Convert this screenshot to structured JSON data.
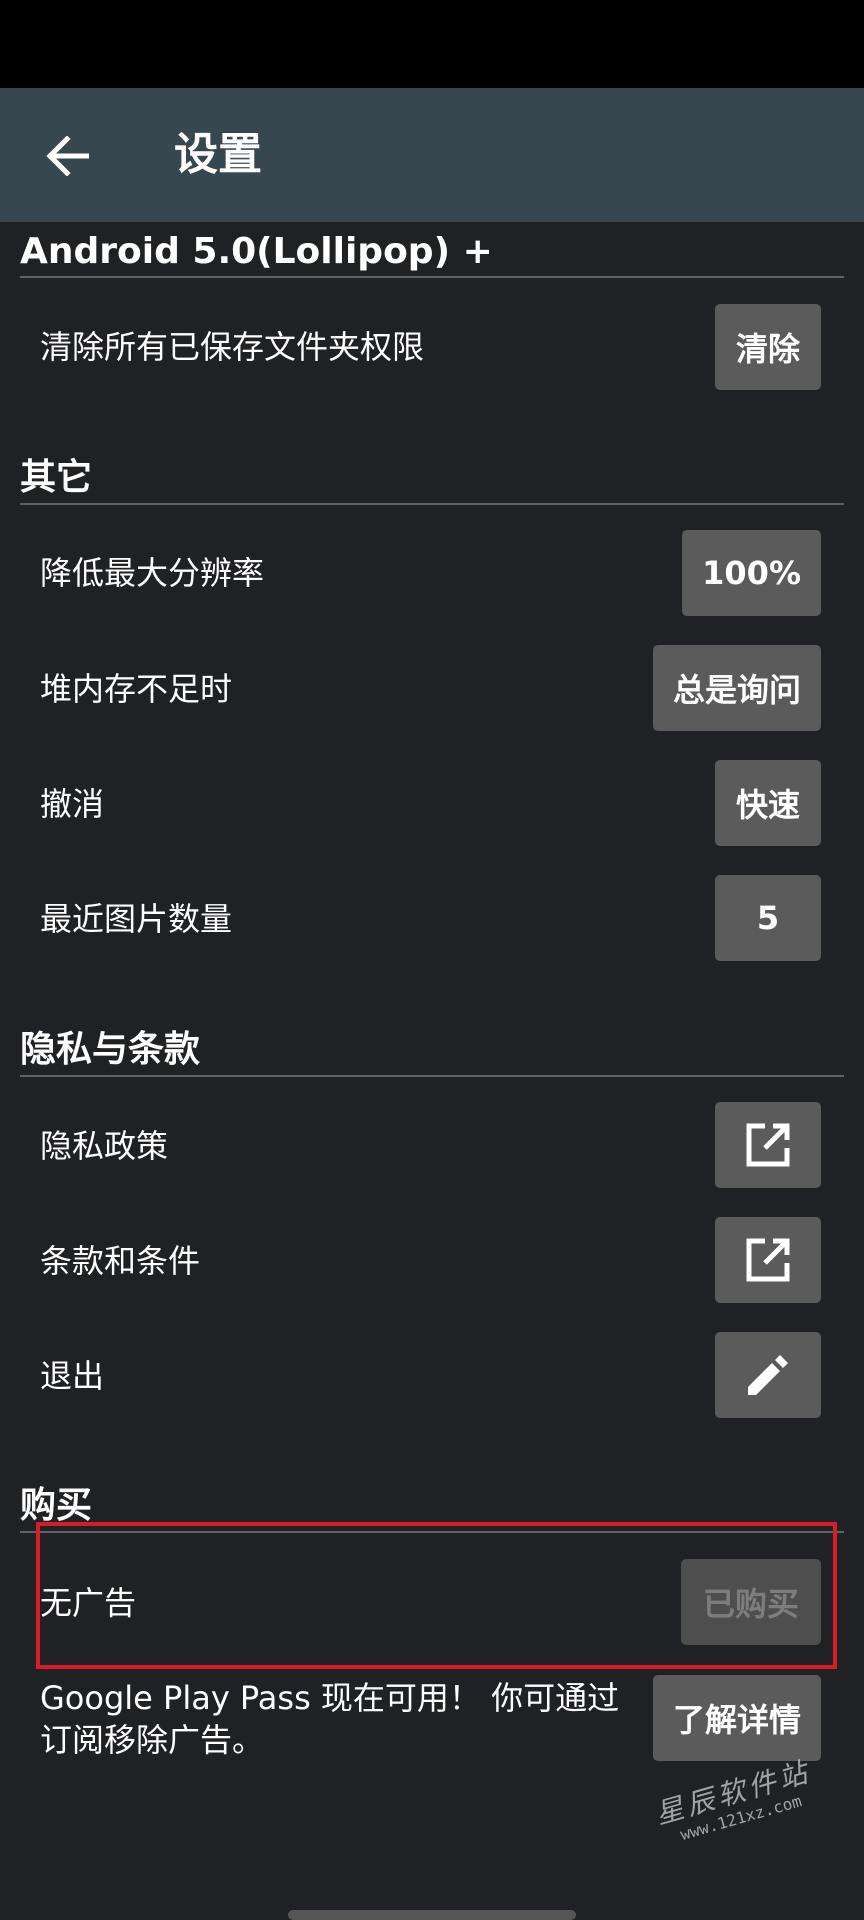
{
  "header": {
    "title": "设置",
    "back_icon": "arrow-left-icon"
  },
  "sections": {
    "android": {
      "title": "Android 5.0(Lollipop) +",
      "clear_permissions": {
        "label": "清除所有已保存文件夹权限",
        "button": "清除"
      }
    },
    "other": {
      "title": "其它",
      "reduce_resolution": {
        "label": "降低最大分辨率",
        "button": "100%"
      },
      "heap_insufficient": {
        "label": "堆内存不足时",
        "button": "总是询问"
      },
      "undo": {
        "label": "撤消",
        "button": "快速"
      },
      "recent_images": {
        "label": "最近图片数量",
        "button": "5"
      }
    },
    "privacy": {
      "title": "隐私与条款",
      "privacy_policy": {
        "label": "隐私政策",
        "icon": "open-external-icon"
      },
      "terms": {
        "label": "条款和条件",
        "icon": "open-external-icon"
      },
      "exit": {
        "label": "退出",
        "icon": "pencil-icon"
      }
    },
    "purchase": {
      "title": "购买",
      "no_ads": {
        "label": "无广告",
        "button": "已购买"
      },
      "play_pass": {
        "text": "Google Play Pass 现在可用！ 你可通过订阅移除广告。",
        "button": "了解详情"
      }
    }
  },
  "watermark": {
    "name": "星辰软件站",
    "url": "www.121xz.com"
  },
  "colors": {
    "background": "#202125",
    "app_bar": "#37474f",
    "button": "#5b5b5b",
    "highlight": "#d81b24"
  }
}
